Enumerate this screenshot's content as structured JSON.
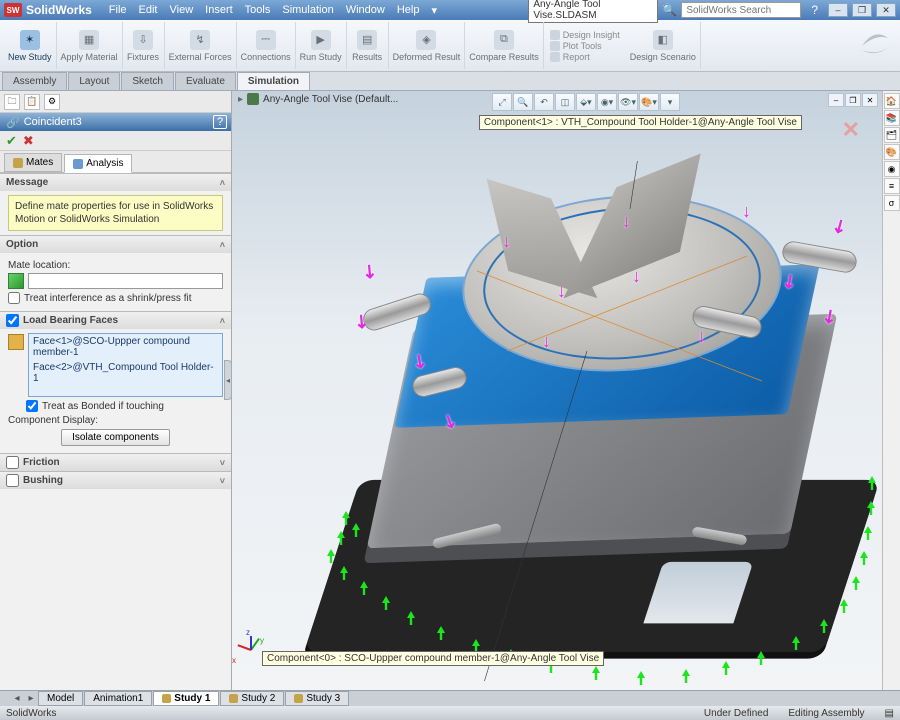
{
  "app": {
    "name": "SolidWorks",
    "document": "Any-Angle Tool Vise.SLDASM",
    "searchPlaceholder": "SolidWorks Search"
  },
  "menu": [
    "File",
    "Edit",
    "View",
    "Insert",
    "Tools",
    "Simulation",
    "Window",
    "Help"
  ],
  "ribbon": {
    "buttons": [
      {
        "label": "New Study",
        "key": "new-study",
        "active": true
      },
      {
        "label": "Apply Material",
        "key": "apply-material"
      },
      {
        "label": "Fixtures",
        "key": "fixtures"
      },
      {
        "label": "External Forces",
        "key": "external-forces"
      },
      {
        "label": "Connections",
        "key": "connections"
      },
      {
        "label": "Run Study",
        "key": "run-study"
      },
      {
        "label": "Results",
        "key": "results"
      },
      {
        "label": "Deformed Result",
        "key": "deformed-result"
      },
      {
        "label": "Compare Results",
        "key": "compare-results"
      }
    ],
    "sub1": [
      "Design Insight",
      "Plot Tools",
      "Report"
    ],
    "scenario": "Design Scenario"
  },
  "tabs": [
    "Assembly",
    "Layout",
    "Sketch",
    "Evaluate",
    "Simulation"
  ],
  "activeTab": "Simulation",
  "propmgr": {
    "title": "Coincident3",
    "subtabs": [
      {
        "label": "Mates",
        "key": "mates"
      },
      {
        "label": "Analysis",
        "key": "analysis",
        "active": true
      }
    ],
    "message": {
      "title": "Message",
      "body": "Define mate properties for use in SolidWorks Motion or SolidWorks Simulation"
    },
    "option": {
      "title": "Option",
      "mateLocLabel": "Mate location:",
      "treatInterference": "Treat interference as a shrink/press fit"
    },
    "loadBearing": {
      "title": "Load Bearing Faces",
      "items": [
        "Face<1>@SCO-Uppper compound member-1",
        "Face<2>@VTH_Compound Tool Holder-1"
      ],
      "treatBonded": "Treat as Bonded if touching",
      "compDisplay": "Component Display:",
      "isolateBtn": "Isolate components"
    },
    "friction": "Friction",
    "bushing": "Bushing"
  },
  "viewport": {
    "title": "Any-Angle Tool Vise (Default...",
    "tooltipTop": "Component<1> : VTH_Compound Tool Holder-1@Any-Angle Tool Vise",
    "tooltipBottom": "Component<0> : SCO-Uppper compound member-1@Any-Angle Tool Vise"
  },
  "bottomTabs": [
    "Model",
    "Animation1",
    "Study 1",
    "Study 2",
    "Study 3"
  ],
  "activeBottomTab": "Study 1",
  "status": {
    "left": "SolidWorks",
    "mid": "Under Defined",
    "right": "Editing Assembly"
  }
}
